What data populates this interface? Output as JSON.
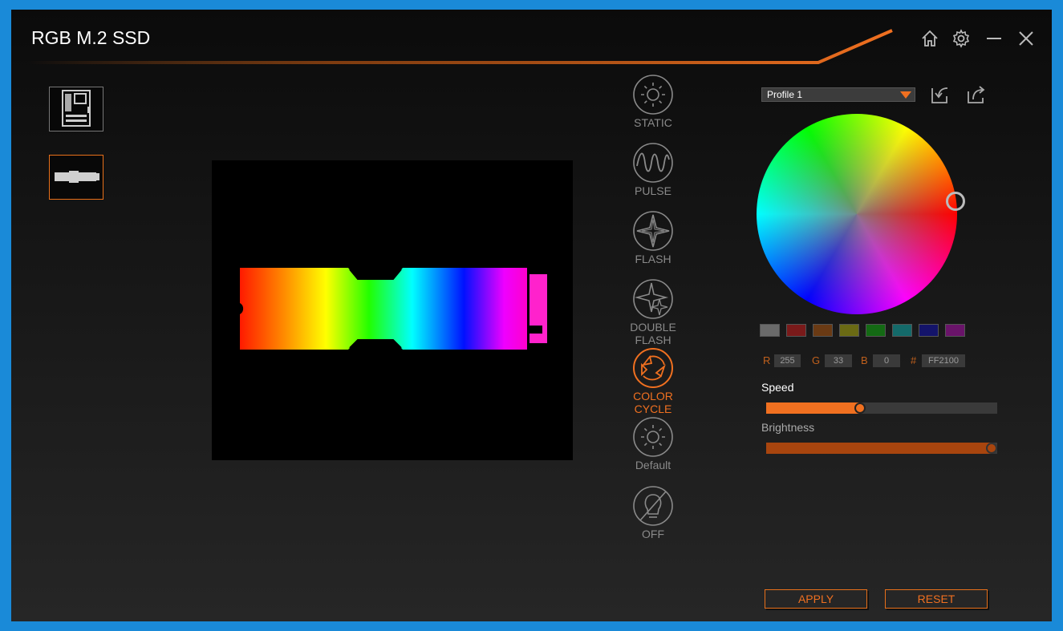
{
  "window": {
    "title": "RGB M.2 SSD"
  },
  "colors": {
    "accent": "#f07020",
    "bg": "#1b1b1b"
  },
  "header": {
    "icons": [
      "home-icon",
      "gear-icon",
      "minimize-icon",
      "close-icon"
    ]
  },
  "devices": [
    {
      "name": "motherboard",
      "active": false
    },
    {
      "name": "m2-ssd",
      "active": true
    }
  ],
  "modes": [
    {
      "id": "static",
      "label": "STATIC",
      "active": false
    },
    {
      "id": "pulse",
      "label": "PULSE",
      "active": false
    },
    {
      "id": "flash",
      "label": "FLASH",
      "active": false
    },
    {
      "id": "double-flash",
      "label_line1": "DOUBLE",
      "label_line2": "FLASH",
      "active": false
    },
    {
      "id": "color-cycle",
      "label_line1": "COLOR",
      "label_line2": "CYCLE",
      "active": true
    },
    {
      "id": "default",
      "label": "Default",
      "active": false
    },
    {
      "id": "off",
      "label": "OFF",
      "active": false
    }
  ],
  "profile": {
    "selected": "Profile 1"
  },
  "presets": [
    "#6a6a6a",
    "#7a1a1a",
    "#6a3a14",
    "#6a6a14",
    "#146a14",
    "#146a6a",
    "#14146a",
    "#6a146a"
  ],
  "rgb": {
    "r_label": "R",
    "r": "255",
    "g_label": "G",
    "g": "33",
    "b_label": "B",
    "b": "0",
    "hex_label": "#",
    "hex": "FF2100"
  },
  "speed": {
    "label": "Speed",
    "value": 0.4
  },
  "brightness": {
    "label": "Brightness",
    "value": 1.0
  },
  "buttons": {
    "apply": "APPLY",
    "reset": "RESET"
  }
}
